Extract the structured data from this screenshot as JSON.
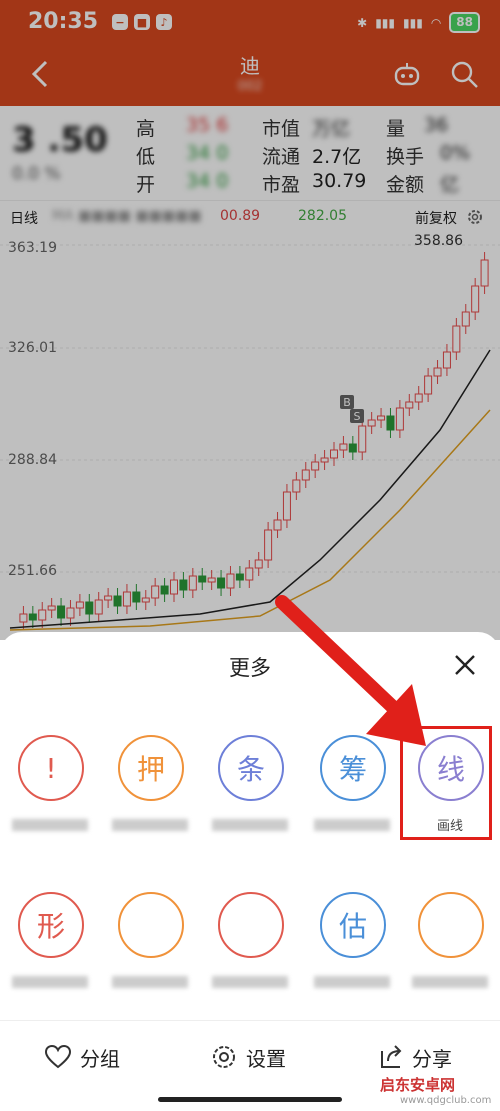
{
  "status": {
    "time": "20:35",
    "battery": "88"
  },
  "nav": {
    "title": "迪",
    "subtitle": "002"
  },
  "quote": {
    "price": "3 .50",
    "change": "0.0 %",
    "high_label": "高",
    "high_value": "35 6",
    "low_label": "低",
    "low_value": "34 0",
    "open_label": "开",
    "open_value": "34 0",
    "mcap_label": "市值",
    "mcap_value": "万亿",
    "float_label": "流通",
    "float_value": "2.7亿",
    "pe_label": "市盈",
    "pe_value": "30.79",
    "vol_label": "量",
    "vol_value": "36",
    "turnover_label": "换手",
    "turnover_value": "0%",
    "amount_label": "金额",
    "amount_value": "亿"
  },
  "kline": {
    "period": "日线",
    "ma_a": "00.89",
    "ma_b": "282.05",
    "adjust": "前复权"
  },
  "chart_data": {
    "type": "candlestick",
    "y_ticks": [
      "363.19",
      "326.01",
      "288.84",
      "251.66"
    ],
    "annotation_high": "358.86",
    "markers": [
      "B",
      "S"
    ]
  },
  "sheet": {
    "title": "更多",
    "row1": [
      {
        "glyph": "!",
        "label": "",
        "color": "#e05a4f"
      },
      {
        "glyph": "押",
        "label": "",
        "color": "#f0923a"
      },
      {
        "glyph": "条",
        "label": "",
        "color": "#6d7fd8"
      },
      {
        "glyph": "筹",
        "label": "",
        "color": "#4a8fd8"
      },
      {
        "glyph": "线",
        "label": "画线",
        "color": "#8a7fd0"
      }
    ],
    "row2": [
      {
        "glyph": "形",
        "label": "",
        "color": "#e05a4f"
      },
      {
        "glyph": "",
        "label": "",
        "color": "#f0923a"
      },
      {
        "glyph": "",
        "label": "",
        "color": "#e05a4f"
      },
      {
        "glyph": "估",
        "label": "",
        "color": "#4a8fd8"
      },
      {
        "glyph": "",
        "label": "",
        "color": "#f0923a"
      }
    ],
    "group_label": "分组",
    "settings_label": "设置",
    "share_label": "分享"
  },
  "watermark": {
    "main": "启东安卓网",
    "sub": "www.qdgclub.com"
  }
}
